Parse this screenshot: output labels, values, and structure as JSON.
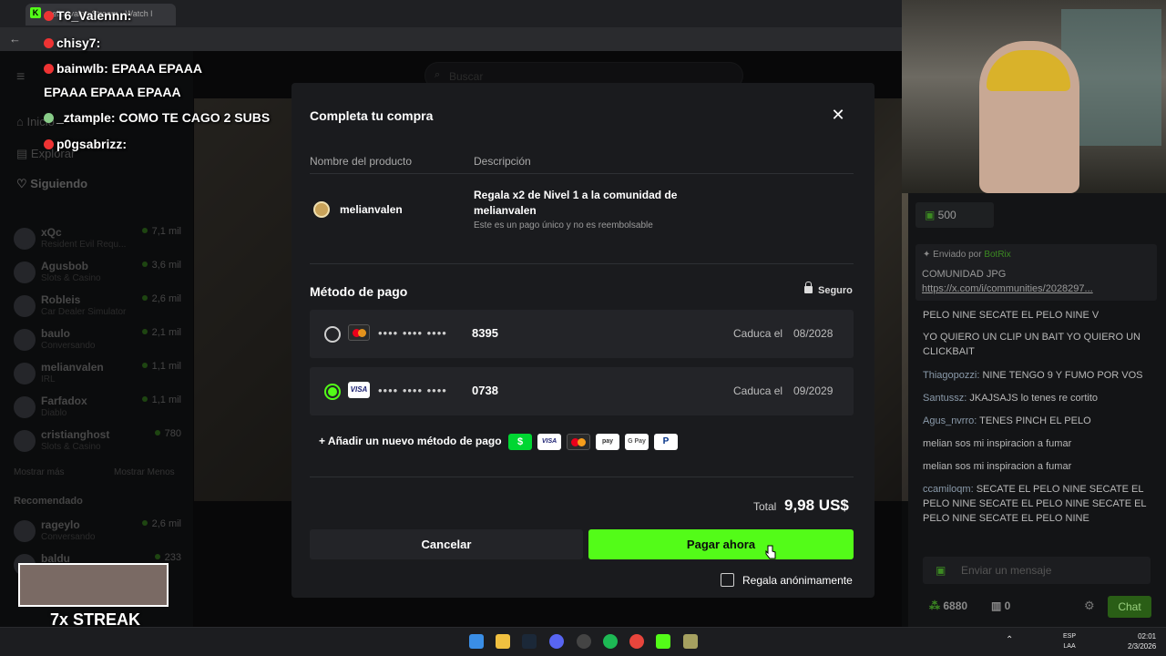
{
  "browser": {
    "tab_title": "melianvalen Stream - Watch l",
    "address": "kick.com/melianvalen"
  },
  "site": {
    "search_placeholder": "Buscar",
    "nav": [
      "Inicio",
      "Explorar",
      "Siguiendo"
    ],
    "channels": [
      {
        "name": "xQc",
        "game": "Resident Evil Requ...",
        "viewers": "7,1 mil"
      },
      {
        "name": "Agusbob",
        "game": "Slots & Casino",
        "viewers": "3,6 mil"
      },
      {
        "name": "Robleis",
        "game": "Car Dealer Simulator",
        "viewers": "2,6 mil"
      },
      {
        "name": "baulo",
        "game": "Conversando",
        "viewers": "2,1 mil"
      },
      {
        "name": "melianvalen",
        "game": "IRL",
        "viewers": "1,1 mil"
      },
      {
        "name": "Farfadox",
        "game": "Diablo",
        "viewers": "1,1 mil"
      },
      {
        "name": "cristianghost",
        "game": "Slots & Casino",
        "viewers": "780"
      }
    ],
    "show_more": "Mostrar más",
    "show_less": "Mostrar Menos",
    "recommended_label": "Recomendado",
    "recommended": [
      {
        "name": "rageylo",
        "game": "Conversando",
        "viewers": "2,6 mil"
      },
      {
        "name": "baldu",
        "game": "",
        "viewers": "233"
      }
    ]
  },
  "overlay_chat": {
    "lines": [
      {
        "user": "T6_Valennn:",
        "text": ""
      },
      {
        "user": "chisy7:",
        "text": ""
      },
      {
        "user": "bainwlb:",
        "text": "EPAAA    EPAAA"
      },
      {
        "user": "",
        "text": "EPAAA    EPAAA    EPAAA"
      },
      {
        "user": "_ztample:",
        "text": "COMO TE CAGO 2 SUBS"
      },
      {
        "user": "p0gsabrizz:",
        "text": ""
      }
    ],
    "streak": "7x STREAK"
  },
  "chat": {
    "gift_count": "500",
    "pinned_by": "Enviado por",
    "pinned_bot": "BotRix",
    "pinned_text": "COMUNIDAD JPG",
    "pinned_link": "https://x.com/i/communities/2028297...",
    "messages": [
      {
        "user": "",
        "text": "PELO NINE SECATE EL PELO NINE V"
      },
      {
        "user": "",
        "text": "YO QUIERO UN CLIP UN BAIT YO QUIERO UN CLICKBAIT"
      },
      {
        "user": "Thiagopozzi:",
        "text": "NINE TENGO 9 Y FUMO POR VOS"
      },
      {
        "user": "Santussz:",
        "text": "JKAJSAJS lo tenes re cortito"
      },
      {
        "user": "Agus_nvrro:",
        "text": "TENES PINCH EL PELO"
      },
      {
        "user": "",
        "text": "melian sos mi inspiracion a fumar"
      },
      {
        "user": "",
        "text": "melian sos mi inspiracion a fumar"
      },
      {
        "user": "ccamiloqm:",
        "text": "SECATE EL PELO NINE SECATE EL PELO NINE SECATE EL PELO NINE SECATE EL PELO NINE SECATE EL PELO NINE"
      }
    ],
    "input_placeholder": "Enviar un mensaje",
    "points": "6880",
    "badge_count": "0",
    "send_label": "Chat"
  },
  "modal": {
    "title": "Completa tu compra",
    "col_product": "Nombre del producto",
    "col_description": "Descripción",
    "product_name": "melianvalen",
    "description": "Regala x2 de Nivel 1 a la comunidad de melianvalen",
    "description_note": "Este es un pago único y no es reembolsable",
    "payment_title": "Método de pago",
    "secure_label": "Seguro",
    "cards": [
      {
        "brand": "mastercard",
        "masked": "•••• •••• ••••",
        "last4": "8395",
        "expires_label": "Caduca el",
        "expires": "08/2028",
        "selected": false
      },
      {
        "brand": "visa",
        "masked": "•••• •••• ••••",
        "last4": "0738",
        "expires_label": "Caduca el",
        "expires": "09/2029",
        "selected": true
      }
    ],
    "add_method": "Añadir un nuevo método de pago",
    "method_icons": [
      "$",
      "VISA",
      "mastercard",
      "pay",
      "G Pay",
      "P"
    ],
    "total_label": "Total",
    "total_value": "9,98 US$",
    "cancel": "Cancelar",
    "pay": "Pagar ahora",
    "anonymous": "Regala anónimamente"
  },
  "taskbar": {
    "lang": "ESP",
    "region": "LAA",
    "time": "02:01",
    "date": "2/3/2026"
  },
  "colors": {
    "accent": "#53fc18",
    "modal_bg": "#1a1b1e",
    "card_bg": "#232428"
  }
}
